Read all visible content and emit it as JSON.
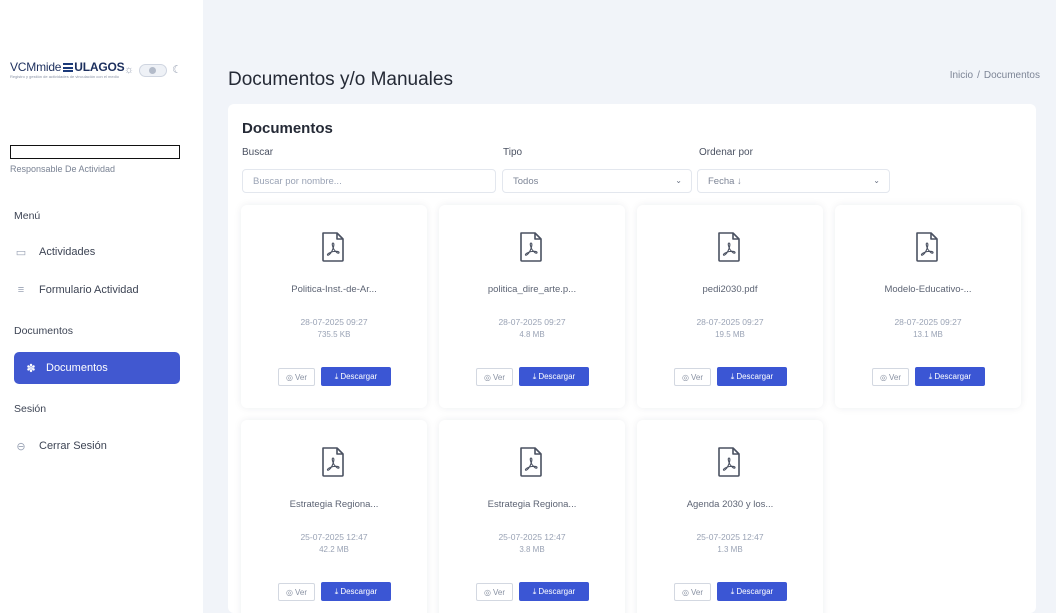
{
  "brand": {
    "name_prefix": "VCMmide",
    "name_suffix": "ULAGOS",
    "tagline": "Registro y gestión de actividades de vinculación con el medio"
  },
  "user": {
    "role": "Responsable De Actividad"
  },
  "sidebar": {
    "menu_title": "Menú",
    "items": [
      {
        "label": "Actividades",
        "icon": "calendar-icon"
      },
      {
        "label": "Formulario Actividad",
        "icon": "list-icon"
      }
    ],
    "docs_title": "Documentos",
    "docs_items": [
      {
        "label": "Documentos",
        "icon": "gear-icon",
        "active": true
      }
    ],
    "session_title": "Sesión",
    "session_items": [
      {
        "label": "Cerrar Sesión",
        "icon": "logout-icon"
      }
    ]
  },
  "header": {
    "title": "Documentos y/o Manuales",
    "breadcrumb": [
      "Inicio",
      "Documentos"
    ]
  },
  "main": {
    "section_title": "Documentos",
    "filters": {
      "search_label": "Buscar",
      "search_placeholder": "Buscar por nombre...",
      "type_label": "Tipo",
      "type_value": "Todos",
      "sort_label": "Ordenar por",
      "sort_value": "Fecha ↓"
    },
    "view_label": "Ver",
    "download_label": "Descargar",
    "documents": [
      {
        "name": "Politica-Inst.-de-Ar...",
        "date": "28-07-2025 09:27",
        "size": "735.5 KB"
      },
      {
        "name": "politica_dire_arte.p...",
        "date": "28-07-2025 09:27",
        "size": "4.8 MB"
      },
      {
        "name": "pedi2030.pdf",
        "date": "28-07-2025 09:27",
        "size": "19.5 MB"
      },
      {
        "name": "Modelo-Educativo-...",
        "date": "28-07-2025 09:27",
        "size": "13.1 MB"
      },
      {
        "name": "Estrategia Regiona...",
        "date": "25-07-2025 12:47",
        "size": "42.2 MB"
      },
      {
        "name": "Estrategia Regiona...",
        "date": "25-07-2025 12:47",
        "size": "3.8 MB"
      },
      {
        "name": "Agenda 2030 y los...",
        "date": "25-07-2025 12:47",
        "size": "1.3 MB"
      }
    ]
  },
  "colors": {
    "accent": "#3b56d4",
    "active_nav": "#4158d0",
    "background": "#f1f4f9"
  }
}
